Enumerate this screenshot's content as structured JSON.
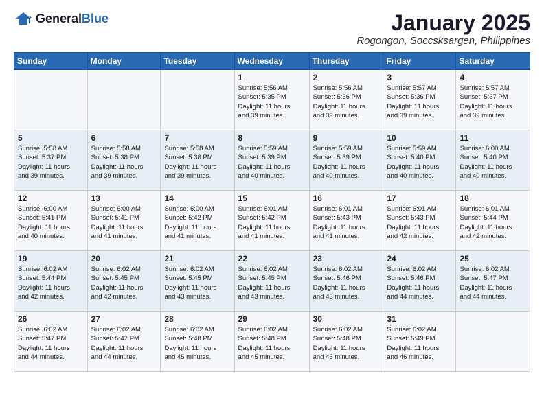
{
  "header": {
    "logo_general": "General",
    "logo_blue": "Blue",
    "month_title": "January 2025",
    "location": "Rogongon, Soccsksargen, Philippines"
  },
  "weekdays": [
    "Sunday",
    "Monday",
    "Tuesday",
    "Wednesday",
    "Thursday",
    "Friday",
    "Saturday"
  ],
  "weeks": [
    [
      {
        "day": "",
        "info": ""
      },
      {
        "day": "",
        "info": ""
      },
      {
        "day": "",
        "info": ""
      },
      {
        "day": "1",
        "info": "Sunrise: 5:56 AM\nSunset: 5:35 PM\nDaylight: 11 hours\nand 39 minutes."
      },
      {
        "day": "2",
        "info": "Sunrise: 5:56 AM\nSunset: 5:36 PM\nDaylight: 11 hours\nand 39 minutes."
      },
      {
        "day": "3",
        "info": "Sunrise: 5:57 AM\nSunset: 5:36 PM\nDaylight: 11 hours\nand 39 minutes."
      },
      {
        "day": "4",
        "info": "Sunrise: 5:57 AM\nSunset: 5:37 PM\nDaylight: 11 hours\nand 39 minutes."
      }
    ],
    [
      {
        "day": "5",
        "info": "Sunrise: 5:58 AM\nSunset: 5:37 PM\nDaylight: 11 hours\nand 39 minutes."
      },
      {
        "day": "6",
        "info": "Sunrise: 5:58 AM\nSunset: 5:38 PM\nDaylight: 11 hours\nand 39 minutes."
      },
      {
        "day": "7",
        "info": "Sunrise: 5:58 AM\nSunset: 5:38 PM\nDaylight: 11 hours\nand 39 minutes."
      },
      {
        "day": "8",
        "info": "Sunrise: 5:59 AM\nSunset: 5:39 PM\nDaylight: 11 hours\nand 40 minutes."
      },
      {
        "day": "9",
        "info": "Sunrise: 5:59 AM\nSunset: 5:39 PM\nDaylight: 11 hours\nand 40 minutes."
      },
      {
        "day": "10",
        "info": "Sunrise: 5:59 AM\nSunset: 5:40 PM\nDaylight: 11 hours\nand 40 minutes."
      },
      {
        "day": "11",
        "info": "Sunrise: 6:00 AM\nSunset: 5:40 PM\nDaylight: 11 hours\nand 40 minutes."
      }
    ],
    [
      {
        "day": "12",
        "info": "Sunrise: 6:00 AM\nSunset: 5:41 PM\nDaylight: 11 hours\nand 40 minutes."
      },
      {
        "day": "13",
        "info": "Sunrise: 6:00 AM\nSunset: 5:41 PM\nDaylight: 11 hours\nand 41 minutes."
      },
      {
        "day": "14",
        "info": "Sunrise: 6:00 AM\nSunset: 5:42 PM\nDaylight: 11 hours\nand 41 minutes."
      },
      {
        "day": "15",
        "info": "Sunrise: 6:01 AM\nSunset: 5:42 PM\nDaylight: 11 hours\nand 41 minutes."
      },
      {
        "day": "16",
        "info": "Sunrise: 6:01 AM\nSunset: 5:43 PM\nDaylight: 11 hours\nand 41 minutes."
      },
      {
        "day": "17",
        "info": "Sunrise: 6:01 AM\nSunset: 5:43 PM\nDaylight: 11 hours\nand 42 minutes."
      },
      {
        "day": "18",
        "info": "Sunrise: 6:01 AM\nSunset: 5:44 PM\nDaylight: 11 hours\nand 42 minutes."
      }
    ],
    [
      {
        "day": "19",
        "info": "Sunrise: 6:02 AM\nSunset: 5:44 PM\nDaylight: 11 hours\nand 42 minutes."
      },
      {
        "day": "20",
        "info": "Sunrise: 6:02 AM\nSunset: 5:45 PM\nDaylight: 11 hours\nand 42 minutes."
      },
      {
        "day": "21",
        "info": "Sunrise: 6:02 AM\nSunset: 5:45 PM\nDaylight: 11 hours\nand 43 minutes."
      },
      {
        "day": "22",
        "info": "Sunrise: 6:02 AM\nSunset: 5:45 PM\nDaylight: 11 hours\nand 43 minutes."
      },
      {
        "day": "23",
        "info": "Sunrise: 6:02 AM\nSunset: 5:46 PM\nDaylight: 11 hours\nand 43 minutes."
      },
      {
        "day": "24",
        "info": "Sunrise: 6:02 AM\nSunset: 5:46 PM\nDaylight: 11 hours\nand 44 minutes."
      },
      {
        "day": "25",
        "info": "Sunrise: 6:02 AM\nSunset: 5:47 PM\nDaylight: 11 hours\nand 44 minutes."
      }
    ],
    [
      {
        "day": "26",
        "info": "Sunrise: 6:02 AM\nSunset: 5:47 PM\nDaylight: 11 hours\nand 44 minutes."
      },
      {
        "day": "27",
        "info": "Sunrise: 6:02 AM\nSunset: 5:47 PM\nDaylight: 11 hours\nand 44 minutes."
      },
      {
        "day": "28",
        "info": "Sunrise: 6:02 AM\nSunset: 5:48 PM\nDaylight: 11 hours\nand 45 minutes."
      },
      {
        "day": "29",
        "info": "Sunrise: 6:02 AM\nSunset: 5:48 PM\nDaylight: 11 hours\nand 45 minutes."
      },
      {
        "day": "30",
        "info": "Sunrise: 6:02 AM\nSunset: 5:48 PM\nDaylight: 11 hours\nand 45 minutes."
      },
      {
        "day": "31",
        "info": "Sunrise: 6:02 AM\nSunset: 5:49 PM\nDaylight: 11 hours\nand 46 minutes."
      },
      {
        "day": "",
        "info": ""
      }
    ]
  ]
}
